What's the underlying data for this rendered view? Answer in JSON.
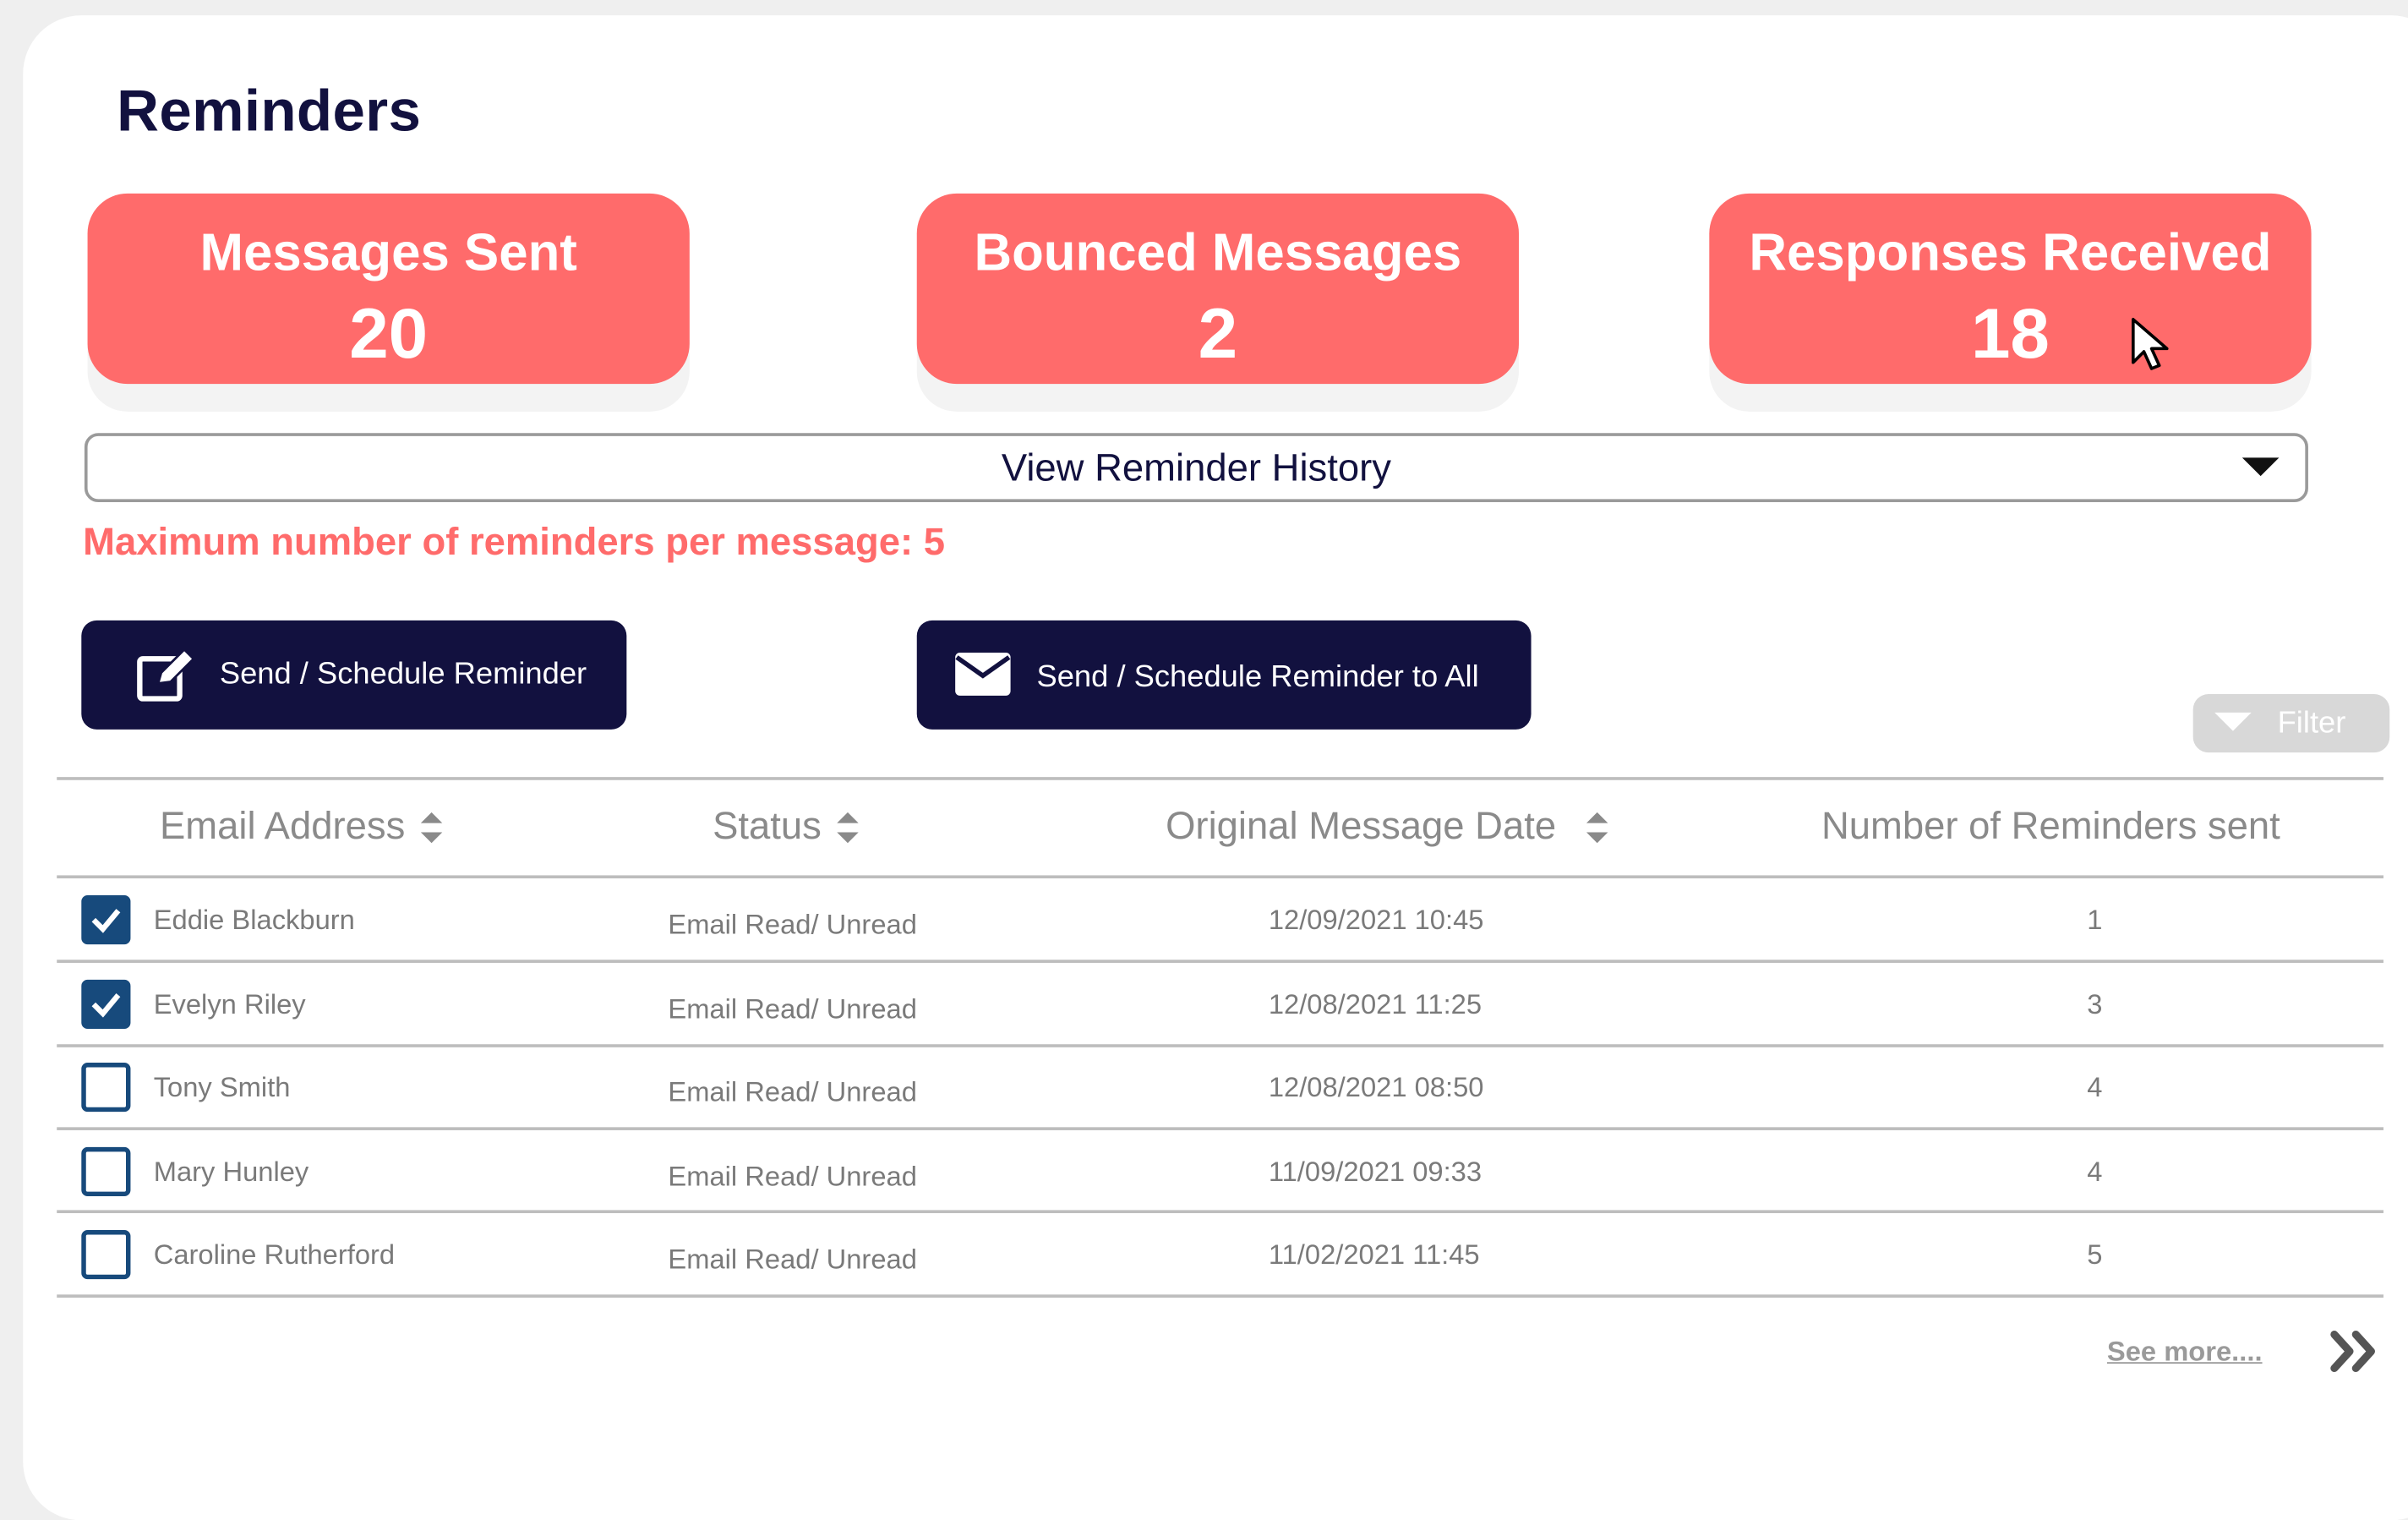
{
  "page": {
    "title": "Reminders"
  },
  "stats": {
    "sent": {
      "label": "Messages Sent",
      "value": "20"
    },
    "bounced": {
      "label": "Bounced Messages",
      "value": "2"
    },
    "responses": {
      "label": "Responses Received",
      "value": "18"
    }
  },
  "history_dropdown": {
    "label": "View Reminder History",
    "icon": "caret-down-icon"
  },
  "max_reminders_note": "Maximum number of reminders per message: 5",
  "actions": {
    "send_label": "Send / Schedule Reminder",
    "send_icon": "edit-icon",
    "send_all_label": "Send / Schedule Reminder to All",
    "send_all_icon": "envelope-icon"
  },
  "filter": {
    "label": "Filter",
    "icon": "filter-icon"
  },
  "table": {
    "columns": [
      "Email Address",
      "Status",
      "Original Message Date",
      "Number of Reminders sent"
    ],
    "rows": [
      {
        "checked": true,
        "email": "Eddie Blackburn",
        "status": "Email Read/ Unread",
        "date": "12/09/2021 10:45",
        "reminders": "1"
      },
      {
        "checked": true,
        "email": "Evelyn Riley",
        "status": "Email Read/ Unread",
        "date": "12/08/2021 11:25",
        "reminders": "3"
      },
      {
        "checked": false,
        "email": "Tony Smith",
        "status": "Email Read/ Unread",
        "date": "12/08/2021 08:50",
        "reminders": "4"
      },
      {
        "checked": false,
        "email": "Mary Hunley",
        "status": "Email Read/ Unread",
        "date": "11/09/2021 09:33",
        "reminders": "4"
      },
      {
        "checked": false,
        "email": "Caroline Rutherford",
        "status": "Email Read/ Unread",
        "date": "11/02/2021 11:45",
        "reminders": "5"
      }
    ]
  },
  "pagination": {
    "see_more_label": "See more....",
    "next_icon": "double-chevron-right-icon"
  },
  "colors": {
    "accent": "#ff6b6b",
    "navy": "#12113f",
    "checkbox": "#174a7c"
  }
}
